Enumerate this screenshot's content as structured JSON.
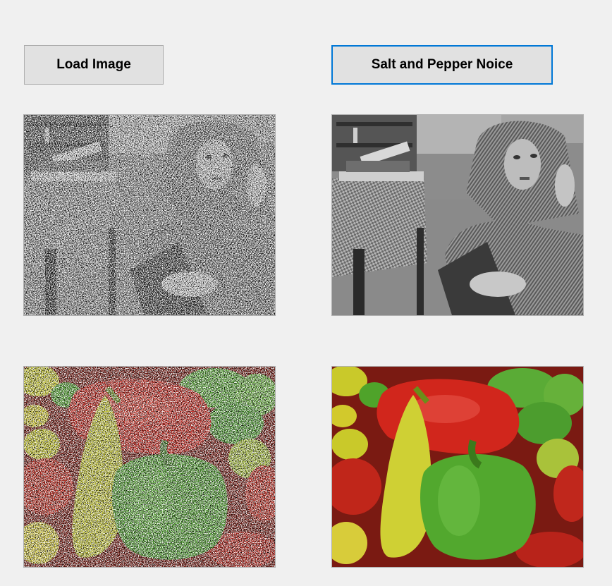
{
  "buttons": {
    "load_label": "Load Image",
    "noise_label": "Salt and Pepper Noice"
  },
  "picture_boxes": {
    "gray_noisy": {
      "content": "grayscale portrait photo with salt-and-pepper noise"
    },
    "gray_clean": {
      "content": "grayscale portrait photo, denoised"
    },
    "color_noisy": {
      "content": "color peppers photo with salt-and-pepper noise"
    },
    "color_clean": {
      "content": "color peppers photo, denoised"
    }
  },
  "colors": {
    "window_bg": "#f0f0f0",
    "button_bg": "#e1e1e1",
    "button_border": "#adadad",
    "focus_border": "#0078d7"
  }
}
